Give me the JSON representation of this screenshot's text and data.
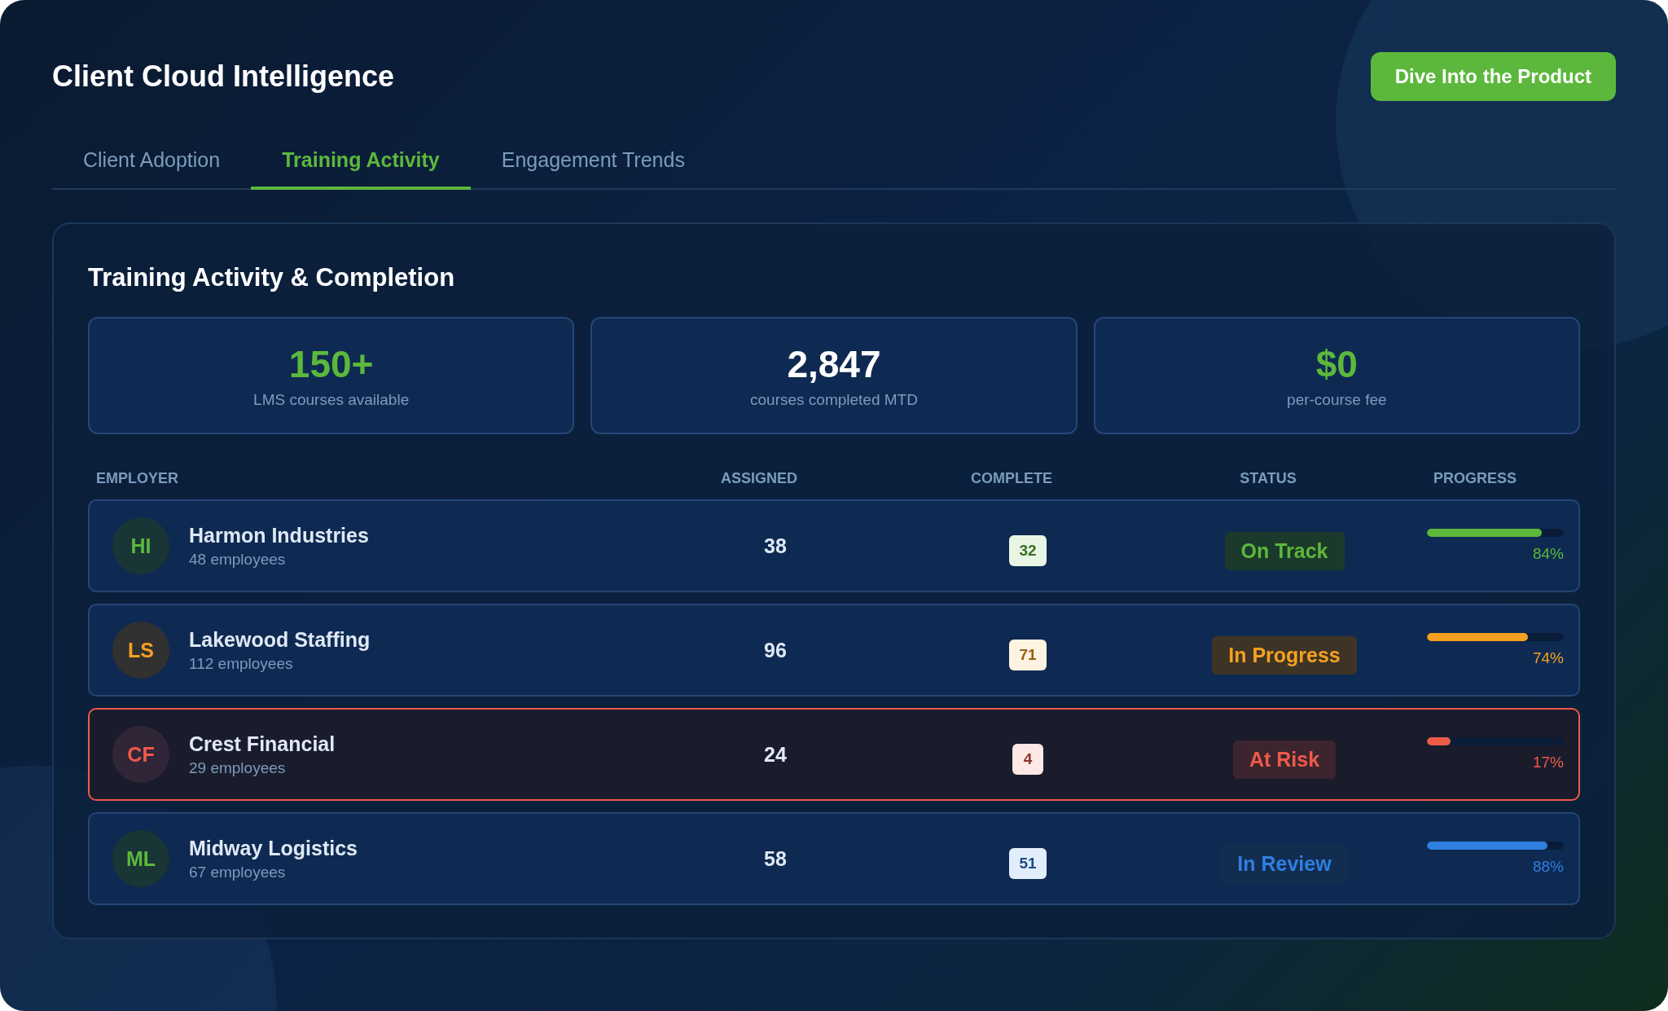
{
  "header": {
    "title": "Client Cloud Intelligence",
    "cta": "Dive Into the Product"
  },
  "tabs": [
    {
      "label": "Client Adoption",
      "selected": false
    },
    {
      "label": "Training Activity",
      "selected": true
    },
    {
      "label": "Engagement Trends",
      "selected": false
    }
  ],
  "panel": {
    "title": "Training Activity & Completion",
    "stats": [
      {
        "value": "150+",
        "label": "LMS courses available",
        "highlight": true
      },
      {
        "value": "2,847",
        "label": "courses completed MTD",
        "highlight": false
      },
      {
        "value": "$0",
        "label": "per-course fee",
        "highlight": true
      }
    ],
    "table": {
      "columns": [
        "EMPLOYER",
        "ASSIGNED",
        "COMPLETE",
        "STATUS",
        "PROGRESS"
      ],
      "rows": [
        {
          "avatar": {
            "initials": "HI",
            "color": "#5cb83c"
          },
          "name": "Harmon Industries",
          "employees": "48 employees",
          "assigned": "38",
          "complete": "32",
          "status": "On Track",
          "color": "#5cb83c",
          "level": 0.84,
          "percent": "84%",
          "flagged": false
        },
        {
          "avatar": {
            "initials": "LS",
            "color": "#f5a020"
          },
          "name": "Lakewood Staffing",
          "employees": "112 employees",
          "assigned": "96",
          "complete": "71",
          "status": "In Progress",
          "color": "#f5a020",
          "level": 0.74,
          "percent": "74%",
          "flagged": false
        },
        {
          "avatar": {
            "initials": "CF",
            "color": "#ee5a4a"
          },
          "name": "Crest Financial",
          "employees": "29 employees",
          "assigned": "24",
          "complete": "4",
          "status": "At Risk",
          "color": "#ee5a4a",
          "level": 0.17,
          "percent": "17%",
          "flagged": true
        },
        {
          "avatar": {
            "initials": "ML",
            "color": "#5cb83c"
          },
          "name": "Midway Logistics",
          "employees": "67 employees",
          "assigned": "58",
          "complete": "51",
          "status": "In Review",
          "color": "#2f7fe0",
          "level": 0.88,
          "percent": "88%",
          "flagged": false
        }
      ]
    }
  }
}
